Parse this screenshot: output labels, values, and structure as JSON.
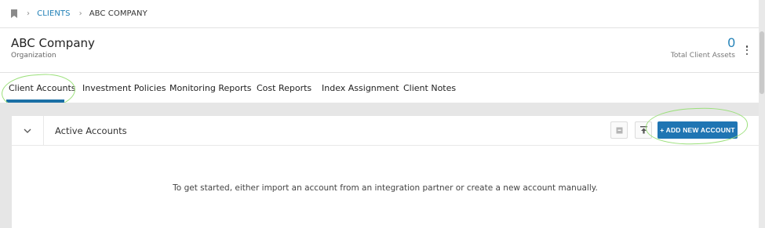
{
  "breadcrumb": {
    "link": "CLIENTS",
    "current": "ABC COMPANY"
  },
  "header": {
    "title": "ABC Company",
    "subtitle": "Organization",
    "assets_value": "0",
    "assets_label": "Total Client Assets"
  },
  "tabs": [
    {
      "label": "Client Accounts",
      "active": true
    },
    {
      "label": "Investment Policies"
    },
    {
      "label": "Monitoring Reports"
    },
    {
      "label": "Cost Reports"
    },
    {
      "label": "Index Assignment"
    },
    {
      "label": "Client Notes"
    }
  ],
  "panel": {
    "title": "Active Accounts",
    "add_button": "+ ADD NEW ACCOUNT",
    "empty_message": "To get started, either import an account from an integration partner or create a new account manually."
  },
  "colors": {
    "accent": "#1f75b3",
    "link": "#1f7fb6",
    "highlight": "#9be07a"
  },
  "icons": [
    "bookmark-icon",
    "chevron-right-icon",
    "kebab-menu-icon",
    "chevron-down-icon",
    "archive-icon",
    "upload-icon"
  ]
}
